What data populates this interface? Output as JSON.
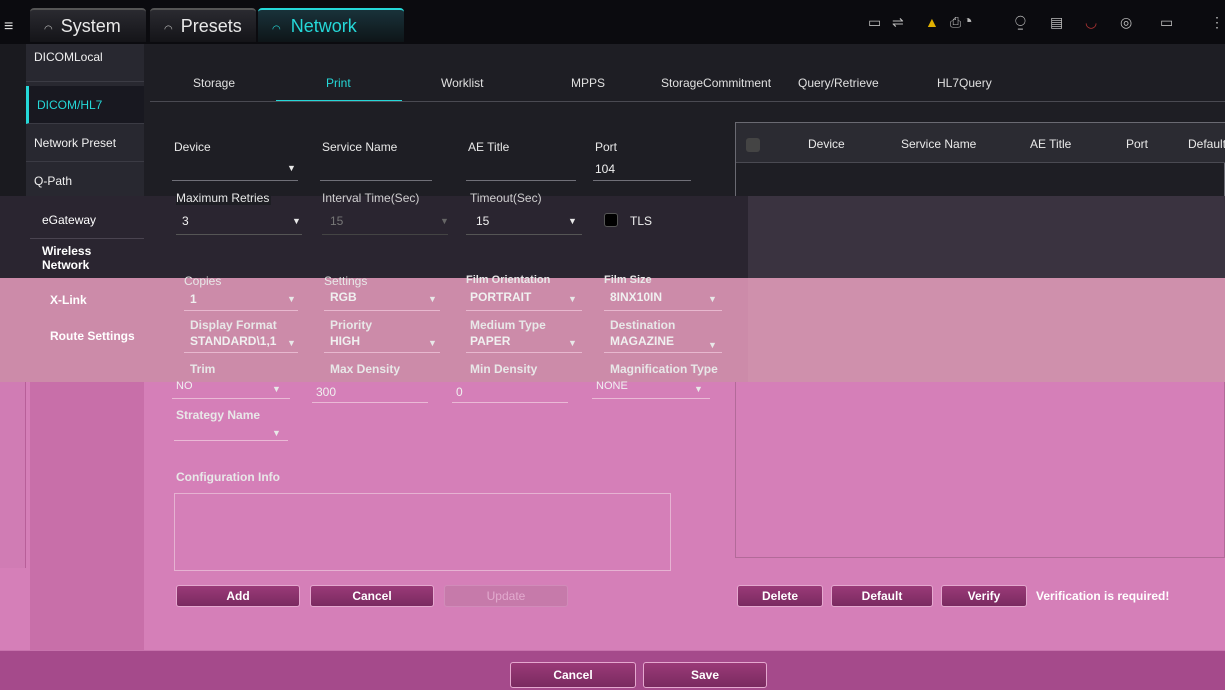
{
  "topbar": {
    "tabs": [
      {
        "label": "System"
      },
      {
        "label": "Presets"
      },
      {
        "label": "Network"
      }
    ],
    "menu_icon": "menu-icon"
  },
  "sidebar": {
    "items": [
      {
        "label": "DICOMLocal"
      },
      {
        "label": "DICOM/HL7"
      },
      {
        "label": "Network Preset"
      },
      {
        "label": "Q-Path"
      },
      {
        "label": "eGateway"
      },
      {
        "label": "Wireless Network"
      },
      {
        "label": "X-Link"
      },
      {
        "label": "Route Settings"
      }
    ]
  },
  "subtabs": [
    {
      "label": "Storage"
    },
    {
      "label": "Print"
    },
    {
      "label": "Worklist"
    },
    {
      "label": "MPPS"
    },
    {
      "label": "StorageCommitment"
    },
    {
      "label": "Query/Retrieve"
    },
    {
      "label": "HL7Query"
    }
  ],
  "form": {
    "device_label": "Device",
    "service_name_label": "Service Name",
    "ae_title_label": "AE Title",
    "port_label": "Port",
    "port_value": "104",
    "max_retries_label": "Maximum Retries",
    "max_retries_value": "3",
    "interval_label": "Interval Time(Sec)",
    "interval_value": "15",
    "timeout_label": "Timeout(Sec)",
    "timeout_value": "15",
    "tls_label": "TLS",
    "copies_label": "Copies",
    "copies_value": "1",
    "settings_label": "Settings",
    "settings_value": "RGB",
    "film_orientation_label": "Film Orientation",
    "film_orientation_value": "PORTRAIT",
    "film_size_label": "Film Size",
    "film_size_value": "8INX10IN",
    "display_format_label": "Display Format",
    "display_format_value": "STANDARD\\1,1",
    "priority_label": "Priority",
    "priority_value": "HIGH",
    "medium_type_label": "Medium Type",
    "medium_type_value": "PAPER",
    "destination_label": "Destination",
    "destination_value": "MAGAZINE",
    "trim_label": "Trim",
    "trim_value": "NO",
    "max_density_label": "Max Density",
    "max_density_value": "300",
    "min_density_label": "Min Density",
    "min_density_value": "0",
    "magnification_label": "Magnification Type",
    "magnification_value": "NONE",
    "strategy_label": "Strategy Name",
    "config_info_label": "Configuration Info"
  },
  "grid": {
    "headers": [
      "Device",
      "Service Name",
      "AE Title",
      "Port",
      "Default"
    ]
  },
  "buttons": {
    "add": "Add",
    "cancel": "Cancel",
    "update": "Update",
    "delete": "Delete",
    "default": "Default",
    "verify": "Verify",
    "verify_msg": "Verification is required!",
    "bottom_cancel": "Cancel",
    "bottom_save": "Save"
  },
  "colors": {
    "accent": "#25d8d8",
    "overlay_pink": "#d57fb8",
    "button": "#8a3070"
  }
}
